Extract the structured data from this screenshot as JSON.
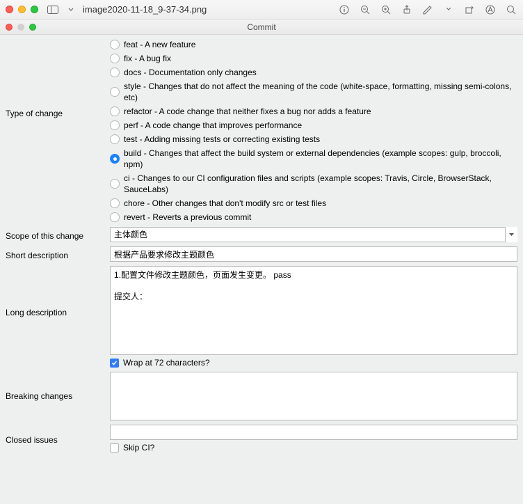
{
  "outer": {
    "title": "image2020-11-18_9-37-34.png"
  },
  "inner": {
    "title": "Commit"
  },
  "labels": {
    "typeOfChange": "Type of change",
    "scope": "Scope of this change",
    "shortDesc": "Short description",
    "longDesc": "Long description",
    "breaking": "Breaking changes",
    "closed": "Closed issues",
    "wrap": "Wrap at 72 characters?",
    "skipCI": "Skip CI?"
  },
  "changeTypes": [
    {
      "label": "feat - A new feature",
      "selected": false
    },
    {
      "label": "fix - A bug fix",
      "selected": false
    },
    {
      "label": "docs - Documentation only changes",
      "selected": false
    },
    {
      "label": "style - Changes that do not affect the meaning of the code (white-space, formatting, missing semi-colons, etc)",
      "selected": false
    },
    {
      "label": "refactor - A code change that neither fixes a bug nor adds a feature",
      "selected": false
    },
    {
      "label": "perf - A code change that improves performance",
      "selected": false
    },
    {
      "label": "test - Adding missing tests or correcting existing tests",
      "selected": false
    },
    {
      "label": "build - Changes that affect the build system or external dependencies (example scopes: gulp, broccoli, npm)",
      "selected": true
    },
    {
      "label": "ci - Changes to our CI configuration files and scripts (example scopes: Travis, Circle, BrowserStack, SauceLabs)",
      "selected": false
    },
    {
      "label": "chore - Other changes that don't modify src or test files",
      "selected": false
    },
    {
      "label": "revert - Reverts a previous commit",
      "selected": false
    }
  ],
  "values": {
    "scope": "主体颜色",
    "shortDesc": "根据产品要求修改主题颜色",
    "longDesc": "1.配置文件修改主题颜色，页面发生变更。 pass\n\n提交人：",
    "breaking": "",
    "closed": "",
    "wrapChecked": true,
    "skipCIChecked": false
  }
}
